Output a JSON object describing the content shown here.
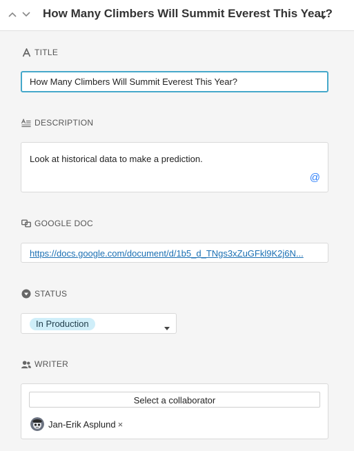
{
  "header": {
    "record_title": "How Many Climbers Will Summit Everest This Year?"
  },
  "fields": {
    "title": {
      "label": "TITLE",
      "value": "How Many Climbers Will Summit Everest This Year?"
    },
    "description": {
      "label": "DESCRIPTION",
      "value": "Look at historical data to make a prediction."
    },
    "google_doc": {
      "label": "GOOGLE DOC",
      "value": "https://docs.google.com/document/d/1b5_d_TNgs3xZuGFkl9K2j6N..."
    },
    "status": {
      "label": "STATUS",
      "value": "In Production"
    },
    "writer": {
      "label": "WRITER",
      "select_label": "Select a collaborator",
      "collaborators": [
        {
          "name": "Jan-Erik Asplund",
          "remove": "×"
        }
      ]
    }
  },
  "icons": {
    "title": "text-a-icon",
    "description": "paragraph-lines-icon",
    "google_doc": "google-doc-icon",
    "status": "status-caret-circle-icon",
    "writer": "collaborator-icon",
    "mention": "@"
  },
  "colors": {
    "focus_border": "#45a8ca",
    "status_pill": "#cfeef9",
    "link": "#1a6fb3",
    "mention": "#2d7ff9"
  }
}
